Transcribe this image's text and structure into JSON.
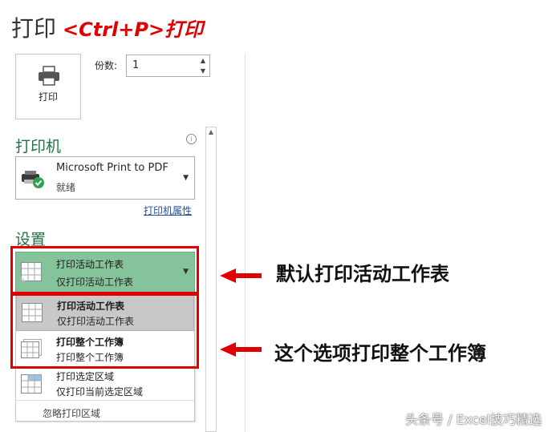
{
  "title": "打印",
  "shortcut_annotation": "<Ctrl+P>打印",
  "print_button": {
    "label": "打印"
  },
  "copies": {
    "label": "份数:",
    "value": "1"
  },
  "printer_section": {
    "heading": "打印机",
    "selected_printer": "Microsoft Print to PDF",
    "status": "就绪",
    "properties_link": "打印机属性"
  },
  "settings_section": {
    "heading": "设置",
    "selected": {
      "title": "打印活动工作表",
      "subtitle": "仅打印活动工作表"
    },
    "options": [
      {
        "title": "打印活动工作表",
        "subtitle": "仅打印活动工作表",
        "selected": true
      },
      {
        "title": "打印整个工作簿",
        "subtitle": "打印整个工作簿",
        "selected": false
      },
      {
        "title": "打印选定区域",
        "subtitle": "仅打印当前选定区域",
        "selected": false
      }
    ],
    "ignore_print_area": "忽略打印区域"
  },
  "callouts": {
    "first": "默认打印活动工作表",
    "second": "这个选项打印整个工作簿"
  },
  "watermark": "头条号 / Excel技巧精选",
  "colors": {
    "accent_green": "#217346",
    "selected_fill": "#85c39a",
    "annotation_red": "#e00000"
  }
}
